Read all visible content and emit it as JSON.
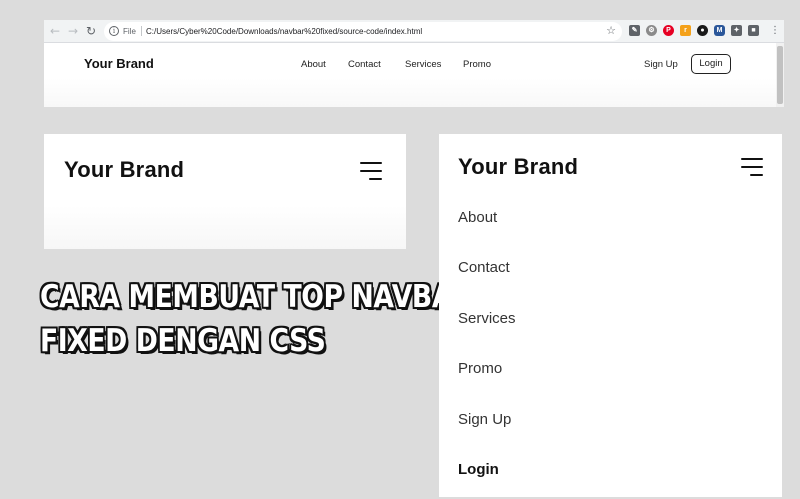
{
  "browser": {
    "address_bar": {
      "protocol_label": "File",
      "url": "C:/Users/Cyber%20Code/Downloads/navbar%20fixed/source-code/index.html"
    },
    "icons": [
      "back-arrow",
      "forward-arrow",
      "reload",
      "info",
      "bookmark-star",
      "extensions",
      "profile",
      "menu-dots"
    ]
  },
  "site_nav": {
    "brand": "Your Brand",
    "links": [
      "About",
      "Contact",
      "Services",
      "Promo"
    ],
    "signup": "Sign Up",
    "login": "Login"
  },
  "mobile_collapsed": {
    "brand": "Your Brand"
  },
  "headline": {
    "line1": "CARA MEMBUAT TOP NAVBAR",
    "line2": "FIXED DENGAN CSS"
  },
  "mobile_expanded": {
    "brand": "Your Brand",
    "menu": [
      "About",
      "Contact",
      "Services",
      "Promo",
      "Sign Up"
    ],
    "login": "Login"
  },
  "colors": {
    "background": "#dcdcdc",
    "text_dark": "#111111",
    "toolbar": "#f1f3f4"
  }
}
